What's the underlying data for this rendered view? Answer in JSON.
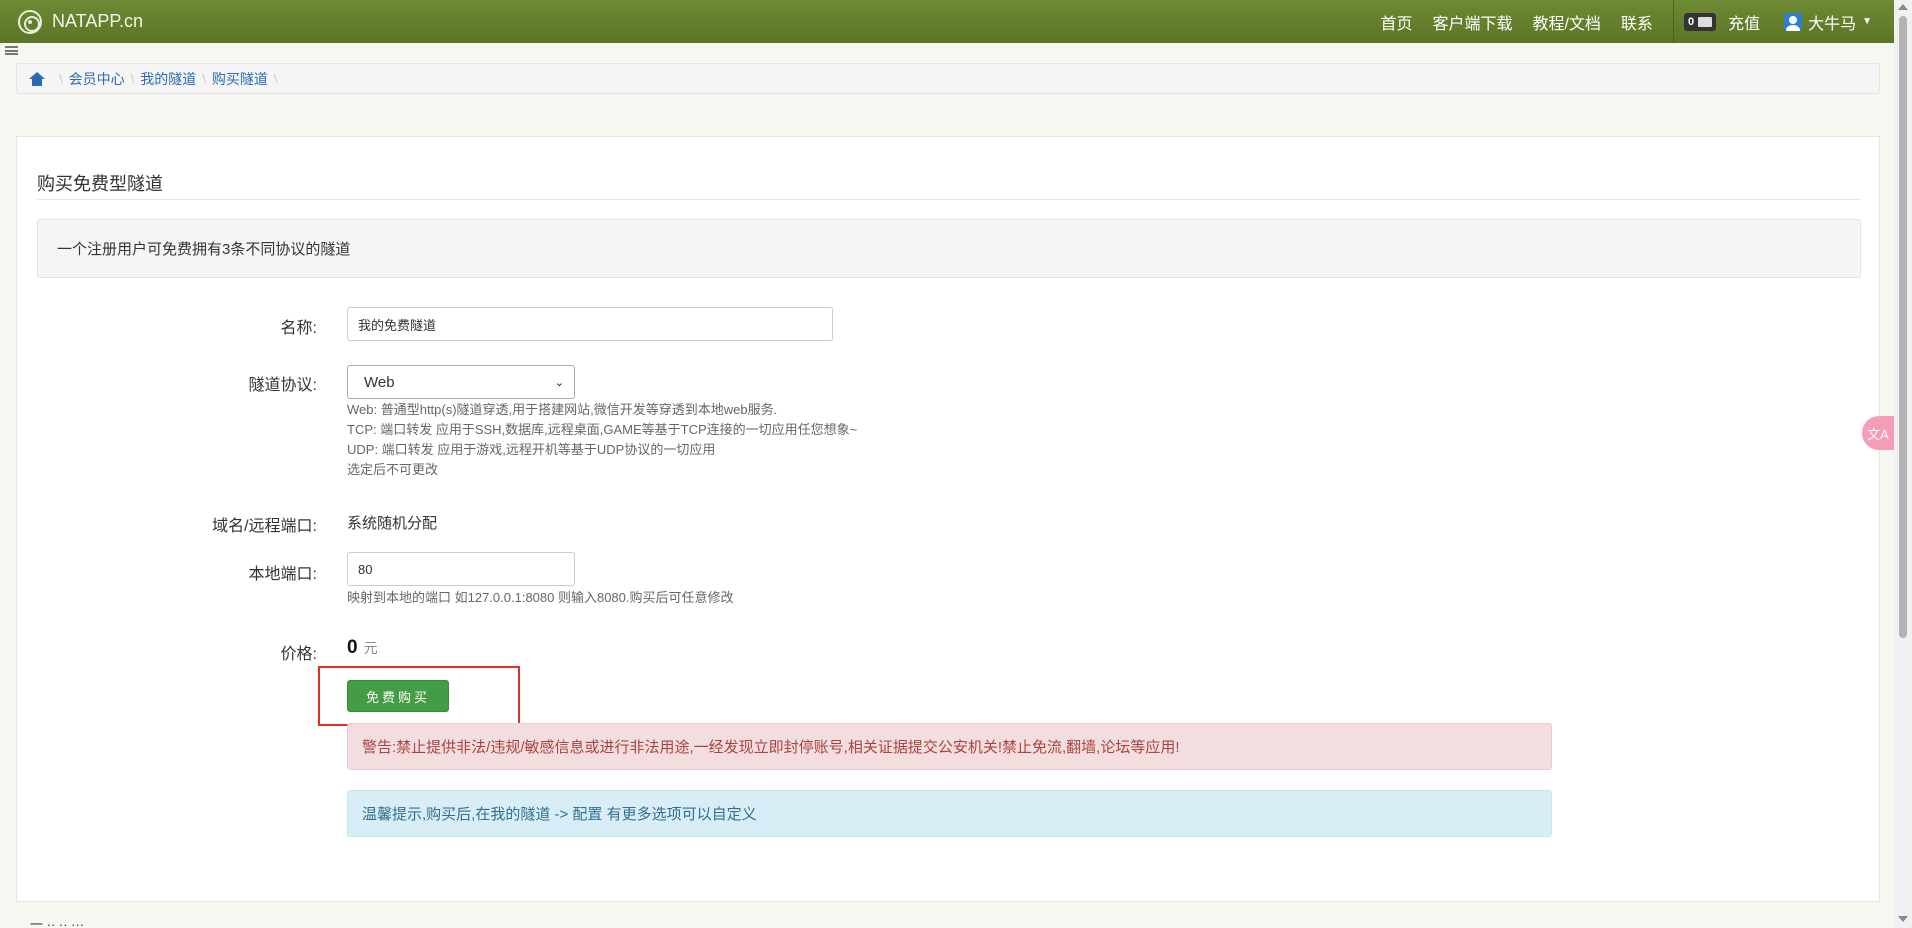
{
  "navbar": {
    "brand": "NATAPP.cn",
    "links": [
      "首页",
      "客户端下载",
      "教程/文档",
      "联系"
    ],
    "balance": "0",
    "recharge_label": "充值",
    "username": "大牛马"
  },
  "breadcrumb": [
    "会员中心",
    "我的隧道",
    "购买隧道"
  ],
  "page": {
    "title": "购买免费型隧道",
    "notice": "一个注册用户可免费拥有3条不同协议的隧道"
  },
  "form": {
    "name_label": "名称:",
    "name_value": "我的免费隧道",
    "protocol_label": "隧道协议:",
    "protocol_selected": "Web",
    "protocol_help": [
      "Web: 普通型http(s)隧道穿透,用于搭建网站,微信开发等穿透到本地web服务.",
      "TCP: 端口转发 应用于SSH,数据库,远程桌面,GAME等基于TCP连接的一切应用任您想象~",
      "UDP: 端口转发 应用于游戏,远程开机等基于UDP协议的一切应用",
      "选定后不可更改"
    ],
    "domain_label": "域名/远程端口:",
    "domain_value": "系统随机分配",
    "local_port_label": "本地端口:",
    "local_port_value": "80",
    "local_port_help": "映射到本地的端口 如127.0.0.1:8080 则输入8080.购买后可任意修改",
    "price_label": "价格:",
    "price_value": "0",
    "price_unit": "元",
    "buy_button": "免费购买"
  },
  "alerts": {
    "warning": "警告:禁止提供非法/违规/敏感信息或进行非法用途,一经发现立即封停账号,相关证据提交公安机关!禁止免流,翻墙,论坛等应用!",
    "tip": "温馨提示,购买后,在我的隧道 -> 配置 有更多选项可以自定义"
  },
  "widgets": {
    "translate_label": "文A"
  },
  "footer_stub": "一 ·· ·· ···"
}
